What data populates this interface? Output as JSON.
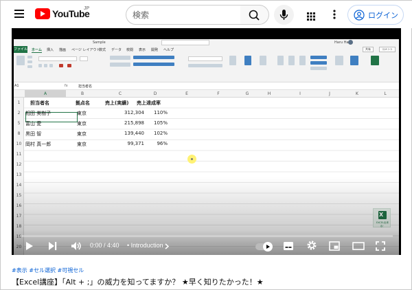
{
  "header": {
    "logo_text": "YouTube",
    "logo_country": "JP",
    "search_placeholder": "検索",
    "login_label": "ログイン"
  },
  "excel": {
    "window_title": "Sample",
    "user_name": "Haru Haru",
    "ribbon_tabs": [
      "ファイル",
      "ホーム",
      "挿入",
      "描画",
      "ページ レイアウト",
      "数式",
      "データ",
      "校閲",
      "表示",
      "開発",
      "ヘルプ"
    ],
    "share_label": "共有",
    "comment_label": "コメント",
    "name_box": "A1",
    "formula_fx": "fx",
    "formula_value": "担当者名",
    "columns": [
      "A",
      "B",
      "C",
      "D",
      "E",
      "F",
      "G",
      "H",
      "I",
      "J",
      "K",
      "L"
    ],
    "rows": [
      "1",
      "2",
      "5",
      "8",
      "10",
      "11",
      "12",
      "13",
      "14",
      "15",
      "16",
      "17",
      "18",
      "19",
      "20"
    ],
    "table": {
      "headers": [
        "担当者名",
        "拠点名",
        "売上(実績)",
        "売上達成率"
      ],
      "body": [
        [
          "相田 美樹子",
          "東京",
          "312,304",
          "110%"
        ],
        [
          "富山 愛",
          "東京",
          "215,898",
          "105%"
        ],
        [
          "黒田 智",
          "東京",
          "139,440",
          "102%"
        ],
        [
          "岡村 真一郎",
          "東京",
          "99,371",
          "96%"
        ]
      ]
    },
    "logo_caption": "EXCEL出来る！"
  },
  "player": {
    "time": "0:00 / 4:40",
    "chapter": "• Introduction",
    "progress_fraction": 0
  },
  "video": {
    "tags": "#表示 #セル選択 #可視セル",
    "title": "【Excel講座】「Alt + ;」の威力を知ってますか？ ★早く知りたかった！★"
  },
  "colors": {
    "brand_red": "#ff0000",
    "link_blue": "#065fd4",
    "excel_green": "#217346"
  }
}
